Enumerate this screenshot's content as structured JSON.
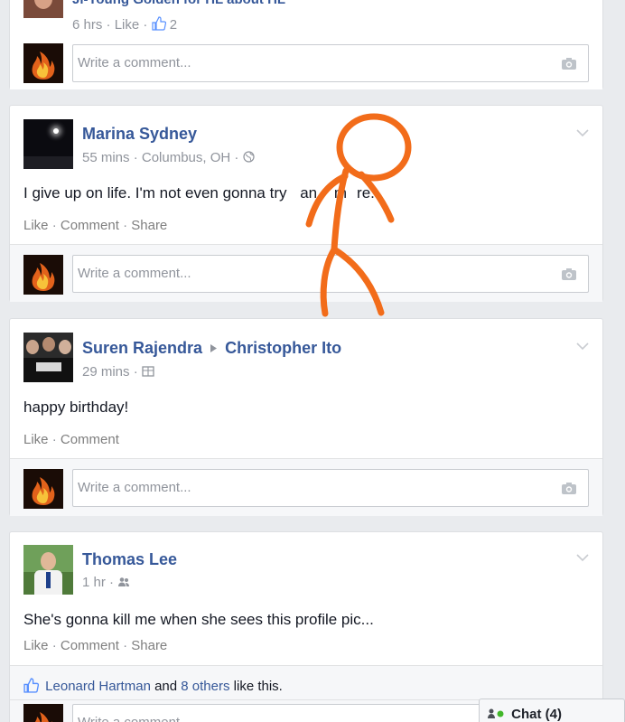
{
  "post0": {
    "author_partial": "Ji-Young Golden for HL about HL",
    "time": "6 hrs",
    "like": "Like",
    "sep": "·",
    "like_count": "2",
    "comment_placeholder": "Write a comment..."
  },
  "post1": {
    "author": "Marina Sydney",
    "time": "55 mins",
    "location": "Columbus, OH",
    "sep": "·",
    "text_a": "I give up on life. I'm not even gonna try",
    "text_b": "an",
    "text_c": "m",
    "text_d": "re.",
    "actions": [
      "Like",
      "Comment",
      "Share"
    ],
    "comment_placeholder": "Write a comment..."
  },
  "post2": {
    "author": "Suren Rajendra",
    "target": "Christopher Ito",
    "time": "29 mins",
    "sep": "·",
    "text": "happy birthday!",
    "actions": [
      "Like",
      "Comment"
    ],
    "comment_placeholder": "Write a comment..."
  },
  "post3": {
    "author": "Thomas Lee",
    "time": "1 hr",
    "sep": "·",
    "text": "She's gonna kill me when she sees this profile pic...",
    "actions": [
      "Like",
      "Comment",
      "Share"
    ],
    "likers_name": "Leonard Hartman",
    "likers_and": "and",
    "likers_others": "8 others",
    "likers_suffix": "like this.",
    "comment_placeholder": "Write a comment..."
  },
  "chat": {
    "label": "Chat (4)"
  },
  "colors": {
    "link": "#365899",
    "stickfigure": "#f26c1a",
    "online": "#42b72a"
  },
  "icons": [
    "camera-icon",
    "globe-icon",
    "friends-icon",
    "chevron-down-icon",
    "thumbs-up-icon",
    "triangle-arrow-icon",
    "chat-online-icon"
  ]
}
